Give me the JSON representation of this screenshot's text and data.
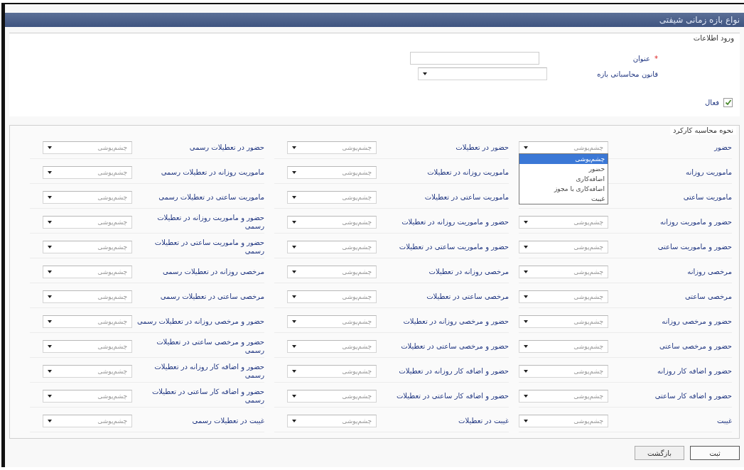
{
  "window": {
    "title": "نواع بازه زمانی شیفتی"
  },
  "info_section": {
    "legend": "ورود اطلاعات",
    "title_field": {
      "label": "عنوان",
      "required_mark": "*"
    },
    "rule_field": {
      "label": "قانون محاسباتی بازه"
    },
    "active": {
      "label": "فعال",
      "checked": true
    }
  },
  "calc_section": {
    "legend": "نحوه محاسبه کارکرد",
    "rows": [
      [
        {
          "label": "حضور",
          "value": "چشم‌پوشی",
          "expanded": true,
          "options": [
            {
              "label": "چشم‌پوشی",
              "selected": true
            },
            {
              "label": "حضور",
              "selected": false
            },
            {
              "label": "اضافه‌کاری",
              "selected": false
            },
            {
              "label": "اضافه‌کاری با مجوز",
              "selected": false
            },
            {
              "label": "غیبت",
              "selected": false
            }
          ]
        },
        {
          "label": "حضور در تعطیلات",
          "value": "چشم‌پوشی"
        },
        {
          "label": "حضور در تعطیلات رسمی",
          "value": "چشم‌پوشی"
        }
      ],
      [
        {
          "label": "ماموریت روزانه"
        },
        {
          "label": "ماموریت روزانه در تعطیلات",
          "value": "چشم‌پوشی"
        },
        {
          "label": "ماموریت روزانه در تعطیلات رسمی",
          "value": "چشم‌پوشی"
        }
      ],
      [
        {
          "label": "ماموریت ساعتی"
        },
        {
          "label": "ماموریت ساعتی در تعطیلات",
          "value": "چشم‌پوشی"
        },
        {
          "label": "ماموریت ساعتی در تعطیلات رسمی",
          "value": "چشم‌پوشی"
        }
      ],
      [
        {
          "label": "حضور و ماموریت روزانه",
          "value": "چشم‌پوشی"
        },
        {
          "label": "حضور و ماموریت روزانه در تعطیلات",
          "value": "چشم‌پوشی"
        },
        {
          "label": "حضور و ماموریت روزانه در تعطیلات رسمی",
          "value": "چشم‌پوشی"
        }
      ],
      [
        {
          "label": "حضور و ماموریت ساعتی",
          "value": "چشم‌پوشی"
        },
        {
          "label": "حضور و ماموریت ساعتی در تعطیلات",
          "value": "چشم‌پوشی"
        },
        {
          "label": "حضور و ماموریت ساعتی در تعطیلات رسمی",
          "value": "چشم‌پوشی"
        }
      ],
      [
        {
          "label": "مرخصی روزانه",
          "value": "چشم‌پوشی"
        },
        {
          "label": "مرخصی روزانه در تعطیلات",
          "value": "چشم‌پوشی"
        },
        {
          "label": "مرخصی روزانه در تعطیلات رسمی",
          "value": "چشم‌پوشی"
        }
      ],
      [
        {
          "label": "مرخصی ساعتی",
          "value": "چشم‌پوشی"
        },
        {
          "label": "مرخصی ساعتی در تعطیلات",
          "value": "چشم‌پوشی"
        },
        {
          "label": "مرخصی ساعتی در تعطیلات رسمی",
          "value": "چشم‌پوشی"
        }
      ],
      [
        {
          "label": "حضور و مرخصی روزانه",
          "value": "چشم‌پوشی"
        },
        {
          "label": "حضور و مرخصی روزانه در تعطیلات",
          "value": "چشم‌پوشی"
        },
        {
          "label": "حضور و مرخصی روزانه در تعطیلات رسمی",
          "value": "چشم‌پوشی"
        }
      ],
      [
        {
          "label": "حضور و مرخصی ساعتی",
          "value": "چشم‌پوشی"
        },
        {
          "label": "حضور و مرخصی ساعتی در تعطیلات",
          "value": "چشم‌پوشی"
        },
        {
          "label": "حضور و مرخصی ساعتی در تعطیلات رسمی",
          "value": "چشم‌پوشی"
        }
      ],
      [
        {
          "label": "حضور و اضافه کار روزانه",
          "value": "چشم‌پوشی"
        },
        {
          "label": "حضور و اضافه کار روزانه در تعطیلات",
          "value": "چشم‌پوشی"
        },
        {
          "label": "حضور و اضافه کار روزانه در تعطیلات رسمی",
          "value": "چشم‌پوشی"
        }
      ],
      [
        {
          "label": "حضور و اضافه کار ساعتی",
          "value": "چشم‌پوشی"
        },
        {
          "label": "حضور و اضافه کار ساعتی در تعطیلات",
          "value": "چشم‌پوشی"
        },
        {
          "label": "حضور و اضافه کار ساعتی در تعطیلات رسمی",
          "value": "چشم‌پوشی"
        }
      ],
      [
        {
          "label": "غیبت",
          "value": "چشم‌پوشی"
        },
        {
          "label": "غیبت در تعطیلات",
          "value": "چشم‌پوشی"
        },
        {
          "label": "غیبت در تعطیلات رسمی",
          "value": "چشم‌پوشی"
        }
      ]
    ]
  },
  "buttons": [
    {
      "label": "ثبت",
      "kind": "primary"
    },
    {
      "label": "بازگشت",
      "kind": "secondary"
    }
  ]
}
